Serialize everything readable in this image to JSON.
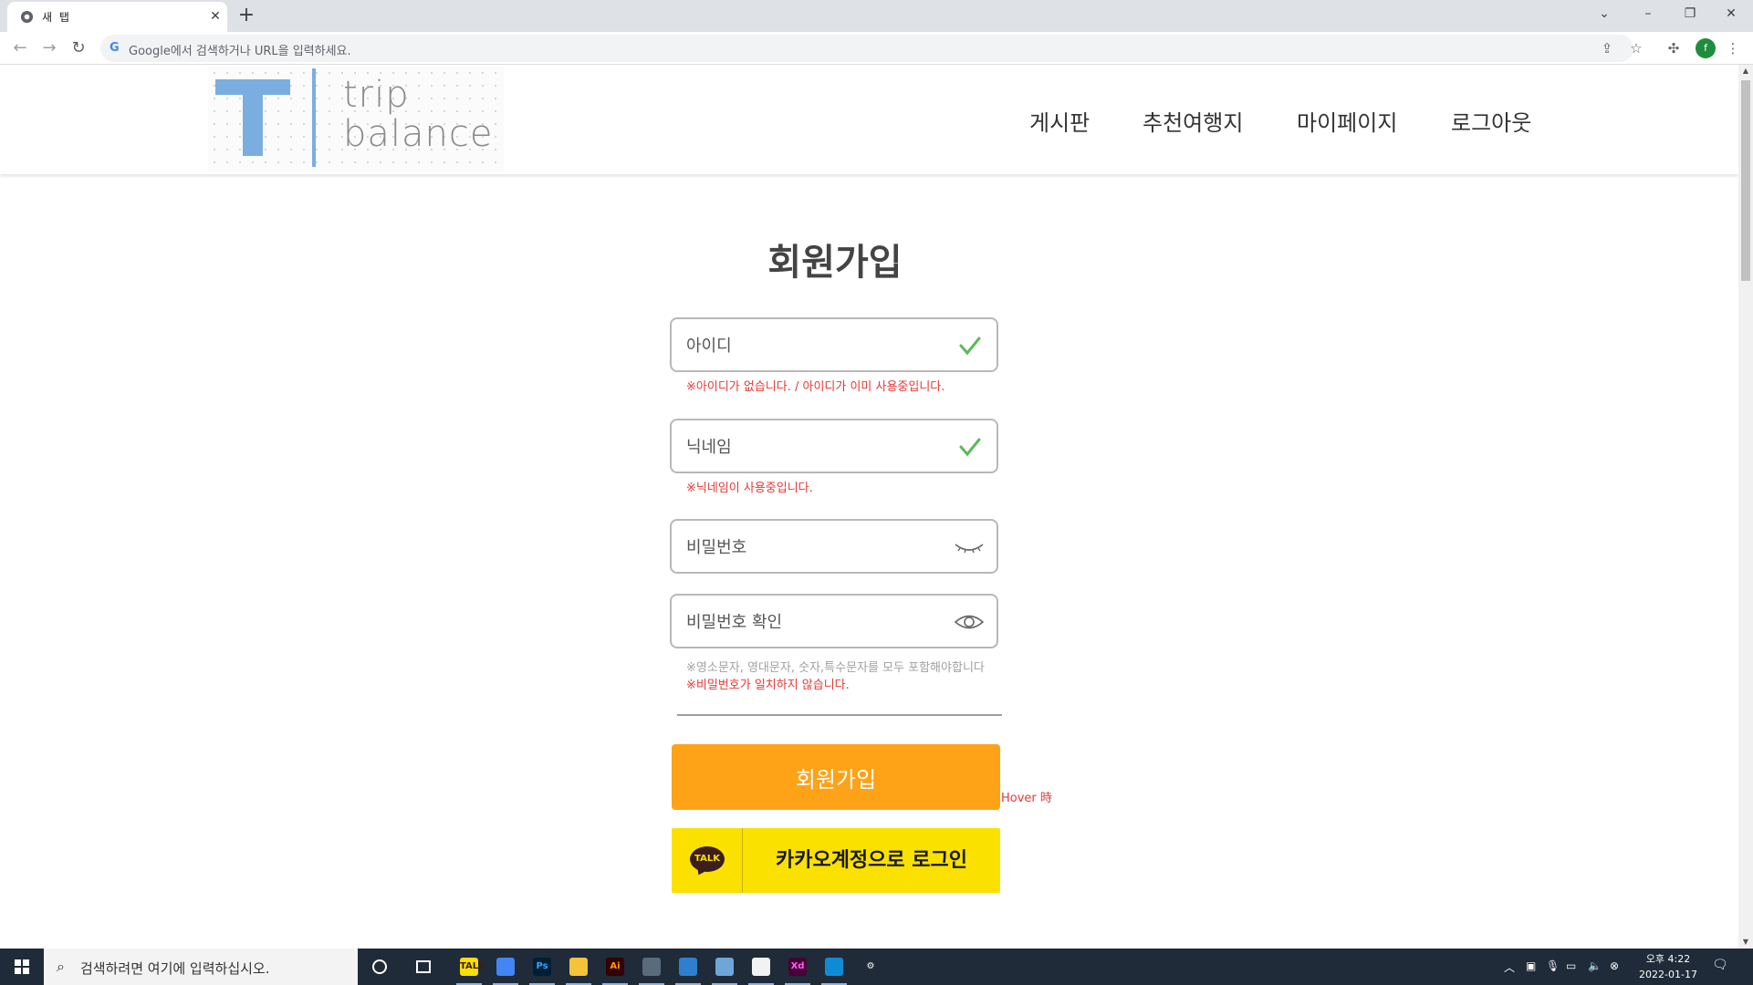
{
  "browser": {
    "tab_title": "새 탭",
    "tab_close": "✕",
    "new_tab": "+",
    "omnibox_placeholder": "Google에서 검색하거나 URL을 입력하세요.",
    "omnibox_g": "G",
    "profile_initial": "f"
  },
  "header": {
    "logo_letter": "T",
    "logo_trip": "trip",
    "logo_balance": "balance",
    "nav": [
      "게시판",
      "추천여행지",
      "마이페이지",
      "로그아웃"
    ]
  },
  "signup": {
    "title": "회원가입",
    "id_placeholder": "아이디",
    "id_message": "※아이디가 없습니다. / 아이디가 이미 사용중입니다.",
    "nickname_placeholder": "닉네임",
    "nickname_message": "※닉네임이 사용중입니다.",
    "password_placeholder": "비밀번호",
    "password_confirm_placeholder": "비밀번호 확인",
    "password_rule": "※영소문자, 영대문자, 숫자,특수문자를 모두 포함해야합니다",
    "password_mismatch": "※비밀번호가 일치하지 않습니다.",
    "submit_label": "회원가입",
    "hover_note": "Hover 時",
    "kakao_icon_text": "TALK",
    "kakao_label": "카카오계정으로 로그인"
  },
  "taskbar": {
    "search_placeholder": "검색하려면 여기에 입력하십시오.",
    "apps": [
      {
        "name": "kakaotalk",
        "label": "TALK",
        "bg": "#f9e000",
        "fg": "#3c1e1e"
      },
      {
        "name": "chrome",
        "label": "",
        "bg": "#4285f4",
        "fg": "#fff"
      },
      {
        "name": "photoshop",
        "label": "Ps",
        "bg": "#001e36",
        "fg": "#31a8ff"
      },
      {
        "name": "file-explorer",
        "label": "",
        "bg": "#f3c33a",
        "fg": "#fff"
      },
      {
        "name": "illustrator",
        "label": "Ai",
        "bg": "#330000",
        "fg": "#ff9a00"
      },
      {
        "name": "calculator",
        "label": "",
        "bg": "#5a6b7c",
        "fg": "#fff"
      },
      {
        "name": "photos",
        "label": "",
        "bg": "#2f7fd1",
        "fg": "#fff"
      },
      {
        "name": "notes",
        "label": "",
        "bg": "#6ea6d9",
        "fg": "#fff"
      },
      {
        "name": "powerpoint-viewer",
        "label": "",
        "bg": "#f2f2f2",
        "fg": "#d24726"
      },
      {
        "name": "adobe-xd",
        "label": "Xd",
        "bg": "#470137",
        "fg": "#ff61f6"
      },
      {
        "name": "edge",
        "label": "",
        "bg": "#0f8bd6",
        "fg": "#fff"
      },
      {
        "name": "settings",
        "label": "⚙",
        "bg": "transparent",
        "fg": "#fff"
      }
    ],
    "clock_time": "오후 4:22",
    "clock_date": "2022-01-17"
  },
  "colors": {
    "accent_orange": "#fea217",
    "kakao_yellow": "#fae100",
    "logo_blue": "#7aaee0",
    "error_red": "#e53935",
    "check_green": "#5cb85c"
  }
}
